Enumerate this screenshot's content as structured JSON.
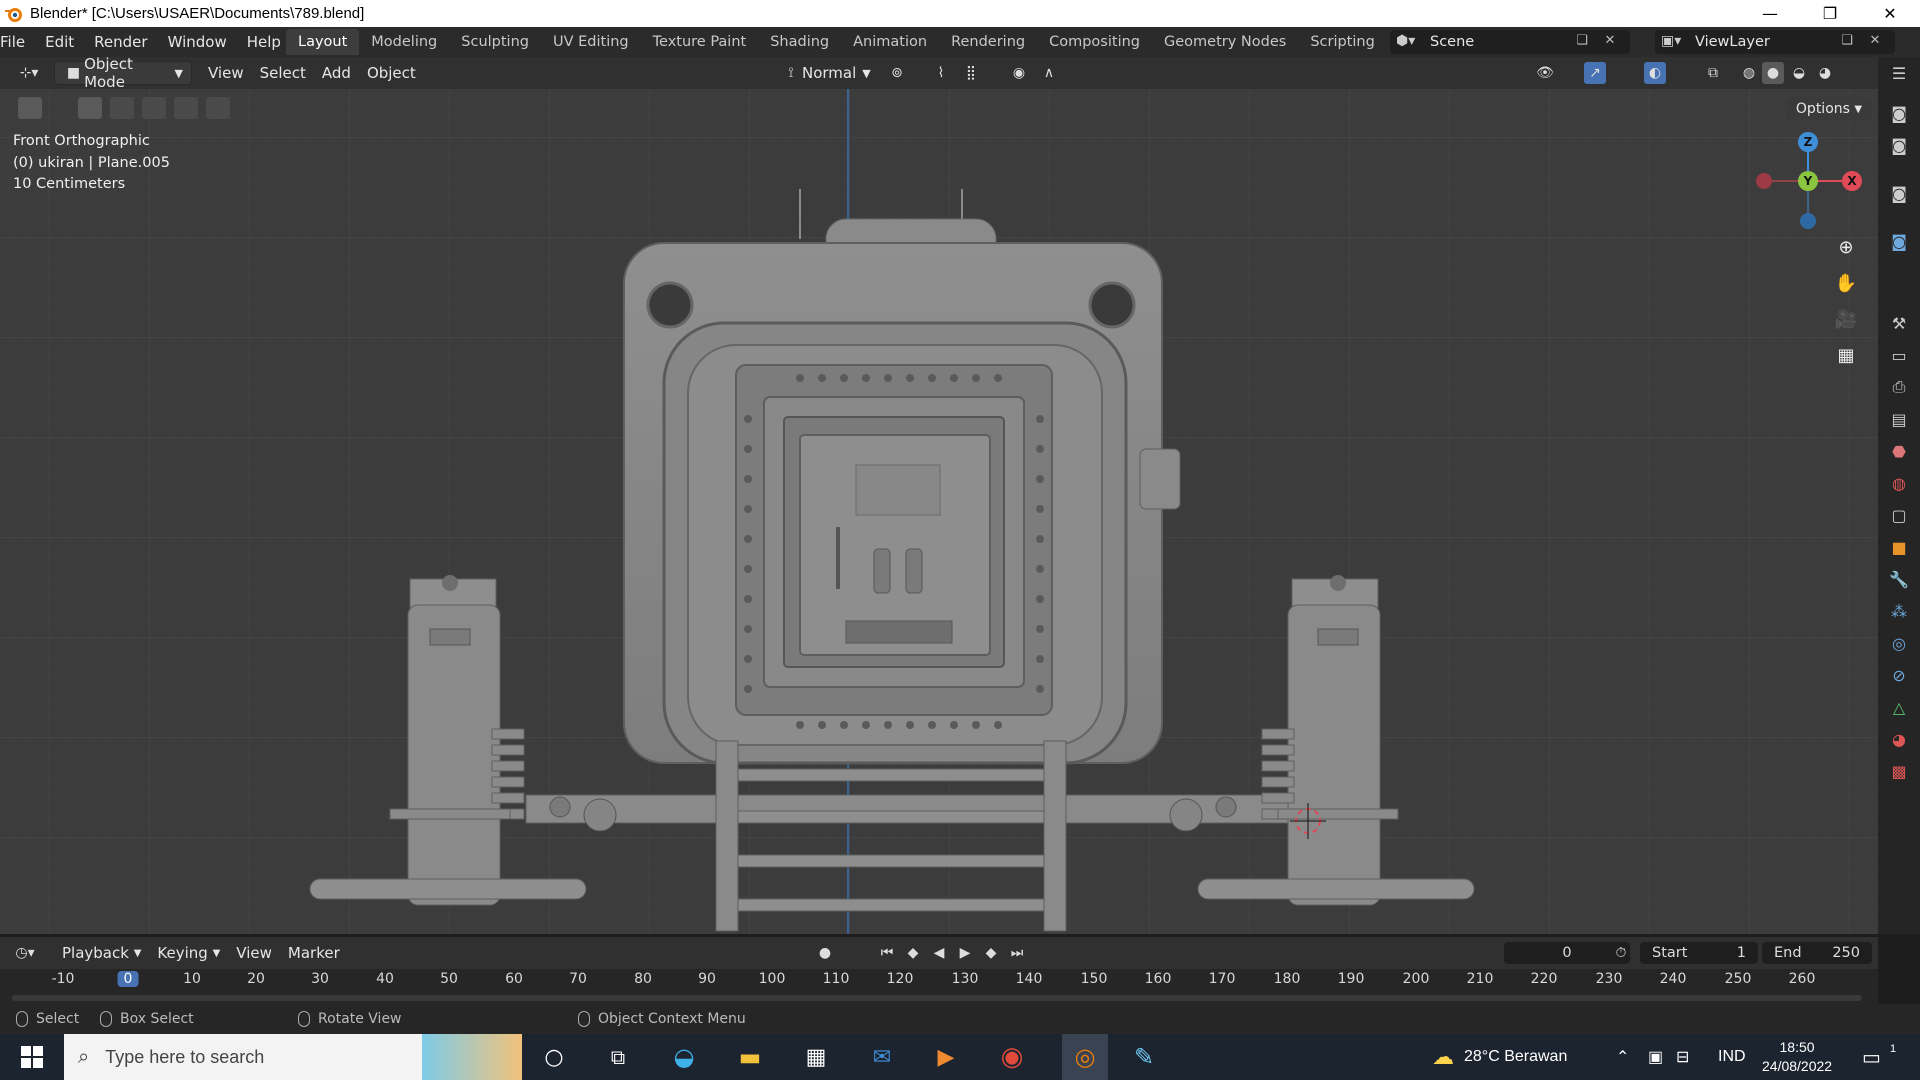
{
  "titlebar": {
    "title": "Blender* [C:\\Users\\USAER\\Documents\\789.blend]",
    "minimize": "—",
    "restore": "❐",
    "close": "✕"
  },
  "menu": {
    "items": [
      "File",
      "Edit",
      "Render",
      "Window",
      "Help"
    ]
  },
  "workspaces": {
    "tabs": [
      "Layout",
      "Modeling",
      "Sculpting",
      "UV Editing",
      "Texture Paint",
      "Shading",
      "Animation",
      "Rendering",
      "Compositing",
      "Geometry Nodes",
      "Scripting"
    ],
    "active": "Layout",
    "add": "+"
  },
  "scene": {
    "label": "Scene"
  },
  "viewlayer": {
    "label": "ViewLayer"
  },
  "viewport_header": {
    "mode": "Object Mode",
    "view": "View",
    "select": "Select",
    "add": "Add",
    "object": "Object",
    "orientation": "Normal"
  },
  "viewport": {
    "view_name": "Front Orthographic",
    "collection_object": "(0) ukiran | Plane.005",
    "scale": "10 Centimeters",
    "options": "Options",
    "gizmo": {
      "z": "Z",
      "y": "Y",
      "x": "X"
    }
  },
  "timeline": {
    "playback": "Playback",
    "keying": "Keying",
    "view": "View",
    "marker": "Marker",
    "current_frame": "0",
    "start_label": "Start",
    "start": "1",
    "end_label": "End",
    "end": "250",
    "ruler": [
      "-10",
      "0",
      "10",
      "20",
      "30",
      "40",
      "50",
      "60",
      "70",
      "80",
      "90",
      "100",
      "110",
      "120",
      "130",
      "140",
      "150",
      "160",
      "170",
      "180",
      "190",
      "200",
      "210",
      "220",
      "230",
      "240",
      "250",
      "260"
    ]
  },
  "statusbar": {
    "select": "Select",
    "box_select": "Box Select",
    "rotate_view": "Rotate View",
    "context_menu": "Object Context Menu"
  },
  "taskbar": {
    "search_placeholder": "Type here to search",
    "weather": "28°C  Berawan",
    "lang": "IND",
    "time": "18:50",
    "date": "24/08/2022",
    "notifications": "1"
  },
  "colors": {
    "accent": "#4772b3",
    "axis_x": "#e04a57",
    "axis_y": "#8bc53f",
    "axis_z": "#3f8fd8"
  }
}
